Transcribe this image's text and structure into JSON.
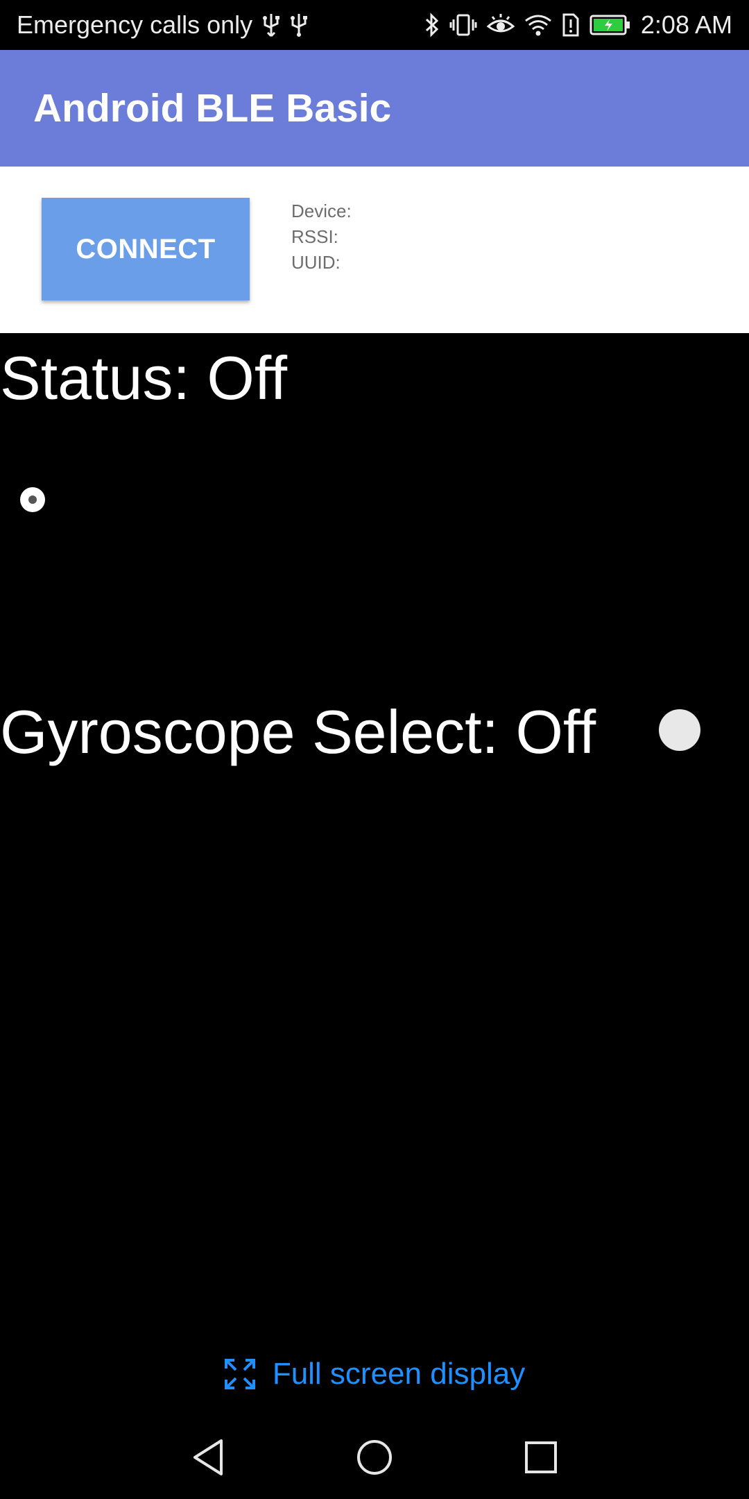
{
  "status_bar": {
    "carrier_text": "Emergency calls only",
    "time": "2:08 AM",
    "icons": [
      "usb-icon",
      "usb-icon",
      "bluetooth-icon",
      "vibrate-icon",
      "eye-icon",
      "wifi-icon",
      "alert-icon",
      "battery-charging-icon"
    ]
  },
  "app_bar": {
    "title": "Android BLE Basic",
    "color": "#6c7dd9"
  },
  "connect_panel": {
    "button_label": "CONNECT",
    "button_color": "#6b9ee8",
    "device_label": "Device:",
    "rssi_label": "RSSI:",
    "uuid_label": "UUID:"
  },
  "body": {
    "status_text": "Status: Off",
    "gyro_text": "Gyroscope Select: Off"
  },
  "fullscreen": {
    "label": "Full screen display",
    "icon": "expand-icon",
    "color": "#1e90ff"
  },
  "nav_bar": {
    "icons": [
      "back-icon",
      "home-icon",
      "recents-icon"
    ]
  }
}
